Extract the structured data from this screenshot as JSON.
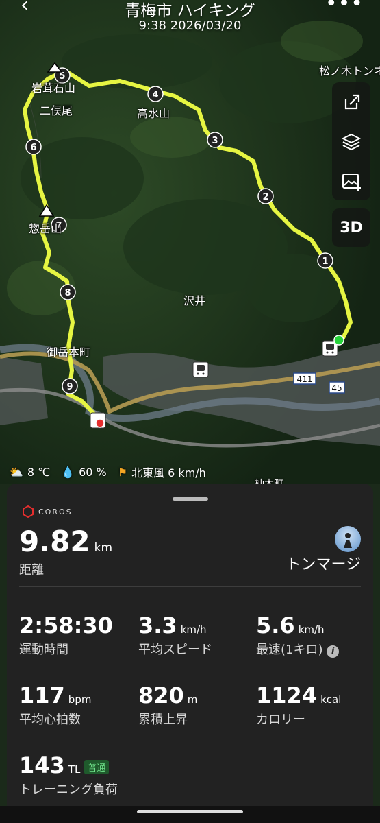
{
  "header": {
    "title": "青梅市 ハイキング",
    "subtitle": "9:38 2026/03/20"
  },
  "map": {
    "places": [
      "松ノ木トンネ",
      "岩茸石山",
      "二俣尾",
      "高水山",
      "惣岳山",
      "沢井",
      "御岳本町",
      "柚木町"
    ],
    "route_labels": [
      "1",
      "2",
      "3",
      "4",
      "5",
      "6",
      "7",
      "8",
      "9"
    ],
    "road_numbers": [
      "411",
      "45"
    ],
    "route_color": "#e6f542",
    "side_buttons": [
      "share-icon",
      "layers-icon",
      "image-add-icon"
    ],
    "btn_3d": "3D"
  },
  "weather": {
    "temp": "8 ℃",
    "humidity": "60 %",
    "wind": "北東風 6 km/h"
  },
  "summary": {
    "brand": "COROS",
    "distance": "9.82",
    "distance_unit": "km",
    "distance_label": "距離",
    "user": "トンマージ",
    "stats": [
      {
        "value": "2:58:30",
        "unit": "",
        "label": "運動時間"
      },
      {
        "value": "3.3",
        "unit": "km/h",
        "label": "平均スピード"
      },
      {
        "value": "5.6",
        "unit": "km/h",
        "label": "最速(1キロ)"
      },
      {
        "value": "117",
        "unit": "bpm",
        "label": "平均心拍数"
      },
      {
        "value": "820",
        "unit": "m",
        "label": "累積上昇"
      },
      {
        "value": "1124",
        "unit": "kcal",
        "label": "カロリー"
      },
      {
        "value": "143",
        "unit": "TL",
        "label": "トレーニング負荷",
        "badge": "普通"
      }
    ]
  }
}
